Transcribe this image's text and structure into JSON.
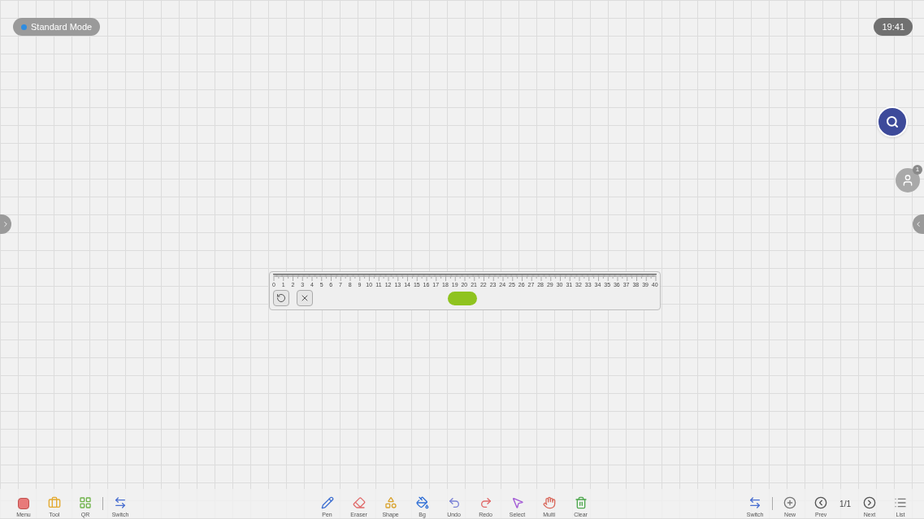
{
  "mode_badge": {
    "label": "Standard Mode"
  },
  "clock": "19:41",
  "user_badge": {
    "count": "1"
  },
  "ruler": {
    "labels": [
      "0",
      "1",
      "2",
      "3",
      "4",
      "5",
      "6",
      "7",
      "8",
      "9",
      "10",
      "11",
      "12",
      "13",
      "14",
      "15",
      "16",
      "17",
      "18",
      "19",
      "20",
      "21",
      "22",
      "23",
      "24",
      "25",
      "26",
      "27",
      "28",
      "29",
      "30",
      "31",
      "32",
      "33",
      "34",
      "35",
      "36",
      "37",
      "38",
      "39",
      "40"
    ]
  },
  "toolbar_left": [
    {
      "kind": "menu",
      "label": "Menu"
    },
    {
      "kind": "tool",
      "label": "Tool"
    },
    {
      "kind": "qr",
      "label": "QR"
    },
    {
      "kind": "switch",
      "label": "Switch"
    }
  ],
  "toolbar_center": [
    {
      "kind": "pen",
      "label": "Pen"
    },
    {
      "kind": "eraser",
      "label": "Eraser"
    },
    {
      "kind": "shape",
      "label": "Shape"
    },
    {
      "kind": "bg",
      "label": "Bg"
    },
    {
      "kind": "undo",
      "label": "Undo"
    },
    {
      "kind": "redo",
      "label": "Redo"
    },
    {
      "kind": "select",
      "label": "Select"
    },
    {
      "kind": "multi",
      "label": "Multi"
    },
    {
      "kind": "clear",
      "label": "Clear"
    }
  ],
  "toolbar_right": [
    {
      "kind": "switch",
      "label": "Switch"
    },
    {
      "kind": "new",
      "label": "New"
    },
    {
      "kind": "prev",
      "label": "Prev"
    },
    {
      "kind": "page",
      "label": "1/1"
    },
    {
      "kind": "next",
      "label": "Next"
    },
    {
      "kind": "list",
      "label": "List"
    }
  ]
}
